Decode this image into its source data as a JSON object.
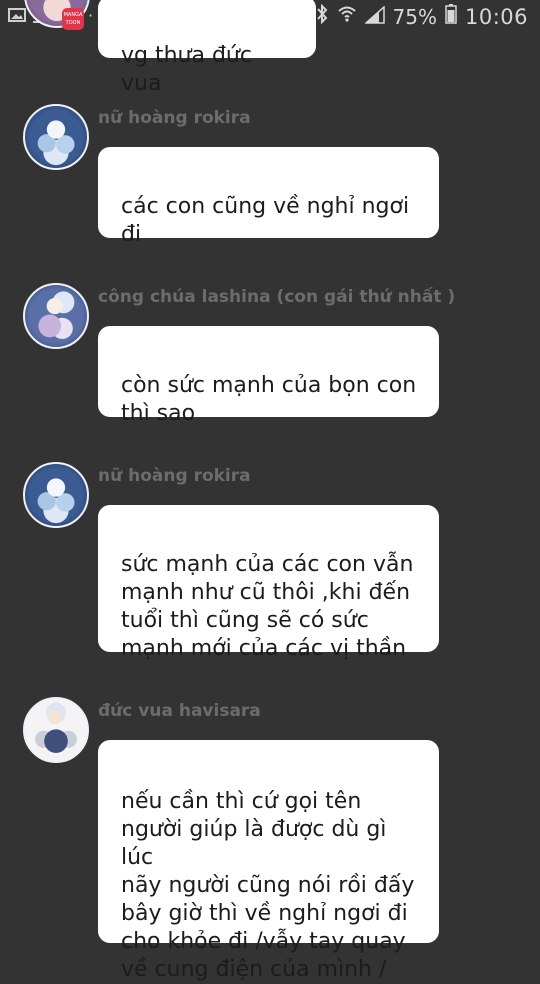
{
  "status_bar": {
    "left_icons": [
      "image-icon",
      "download-icon"
    ],
    "app_badge": [
      "MANGA",
      "TOON"
    ],
    "dot": "·",
    "bluetooth": "✱",
    "battery_percent": "75%",
    "time": "10:06"
  },
  "messages": [
    {
      "sender": "",
      "text": "vg thưa đức vua",
      "avatar": "king-top"
    },
    {
      "sender": "nữ hoàng rokira",
      "text": "các con cũng về nghỉ ngơi\nđi",
      "avatar": "queen-rokira"
    },
    {
      "sender": "công chúa lashina (con gái thứ nhất )",
      "text": "còn sức mạnh của bọn con\nthì sao",
      "avatar": "princess-lashina"
    },
    {
      "sender": "nữ hoàng rokira",
      "text": "sức mạnh của các con vẫn\nmạnh như cũ thôi ,khi đến\ntuổi thì cũng sẽ có sức\nmạnh mới của các vị thần",
      "avatar": "queen-rokira"
    },
    {
      "sender": "đức vua havisara",
      "text": "nếu cần thì cứ gọi tên\nngười giúp là được dù gì lúc\nnãy người cũng nói rồi đấy\nbây giờ thì về nghỉ ngơi đi\ncho khỏe đi /vẫy tay quay\nvề cung điện của mình /",
      "avatar": "king-havisara"
    }
  ]
}
